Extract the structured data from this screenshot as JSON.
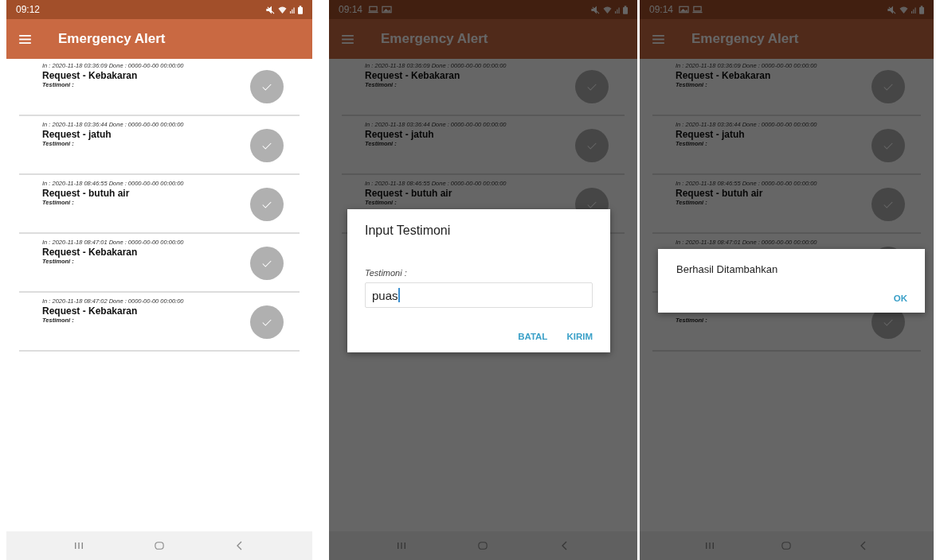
{
  "screens": [
    {
      "status_bar": {
        "time": "09:12"
      },
      "app_bar": {
        "title": "Emergency Alert"
      },
      "dimmed": false,
      "items": [
        {
          "in_line": "In : 2020-11-18 03:36:09  Done : 0000-00-00 00:00:00",
          "title": "Request - Kebakaran",
          "testimoni": "Testimoni :"
        },
        {
          "in_line": "In : 2020-11-18 03:36:44  Done : 0000-00-00 00:00:00",
          "title": "Request - jatuh",
          "testimoni": "Testimoni :"
        },
        {
          "in_line": "In : 2020-11-18 08:46:55  Done : 0000-00-00 00:00:00",
          "title": "Request - butuh air",
          "testimoni": "Testimoni :"
        },
        {
          "in_line": "In : 2020-11-18 08:47:01  Done : 0000-00-00 00:00:00",
          "title": "Request - Kebakaran",
          "testimoni": "Testimoni :"
        },
        {
          "in_line": "In : 2020-11-18 08:47:02  Done : 0000-00-00 00:00:00",
          "title": "Request - Kebakaran",
          "testimoni": "Testimoni :"
        }
      ]
    },
    {
      "status_bar": {
        "time": "09:14"
      },
      "app_bar": {
        "title": "Emergency Alert"
      },
      "dimmed": true,
      "items": [
        {
          "in_line": "In : 2020-11-18 03:36:09  Done : 0000-00-00 00:00:00",
          "title": "Request - Kebakaran",
          "testimoni": "Testimoni :"
        },
        {
          "in_line": "In : 2020-11-18 03:36:44  Done : 0000-00-00 00:00:00",
          "title": "Request - jatuh",
          "testimoni": "Testimoni :"
        },
        {
          "in_line": "In : 2020-11-18 08:46:55  Done : 0000-00-00 00:00:00",
          "title": "Request - butuh air",
          "testimoni": "Testimoni :"
        }
      ],
      "dialog": {
        "kind": "input",
        "title": "Input Testimoni",
        "label": "Testimoni :",
        "value": "puas",
        "buttons": [
          "BATAL",
          "KIRIM"
        ]
      }
    },
    {
      "status_bar": {
        "time": "09:14"
      },
      "app_bar": {
        "title": "Emergency Alert"
      },
      "dimmed": true,
      "items": [
        {
          "in_line": "In : 2020-11-18 03:36:09  Done : 0000-00-00 00:00:00",
          "title": "Request - Kebakaran",
          "testimoni": "Testimoni :"
        },
        {
          "in_line": "In : 2020-11-18 03:36:44  Done : 0000-00-00 00:00:00",
          "title": "Request - jatuh",
          "testimoni": "Testimoni :"
        },
        {
          "in_line": "In : 2020-11-18 08:46:55  Done : 0000-00-00 00:00:00",
          "title": "Request - butuh air",
          "testimoni": "Testimoni :"
        },
        {
          "in_line": "In : 2020-11-18 08:47:01  Done : 0000-00-00 00:00:00"
        },
        {
          "testimoni": "Testimoni :"
        }
      ],
      "dialog": {
        "kind": "message",
        "message": "Berhasil Ditambahkan",
        "buttons": [
          "OK"
        ]
      }
    }
  ]
}
